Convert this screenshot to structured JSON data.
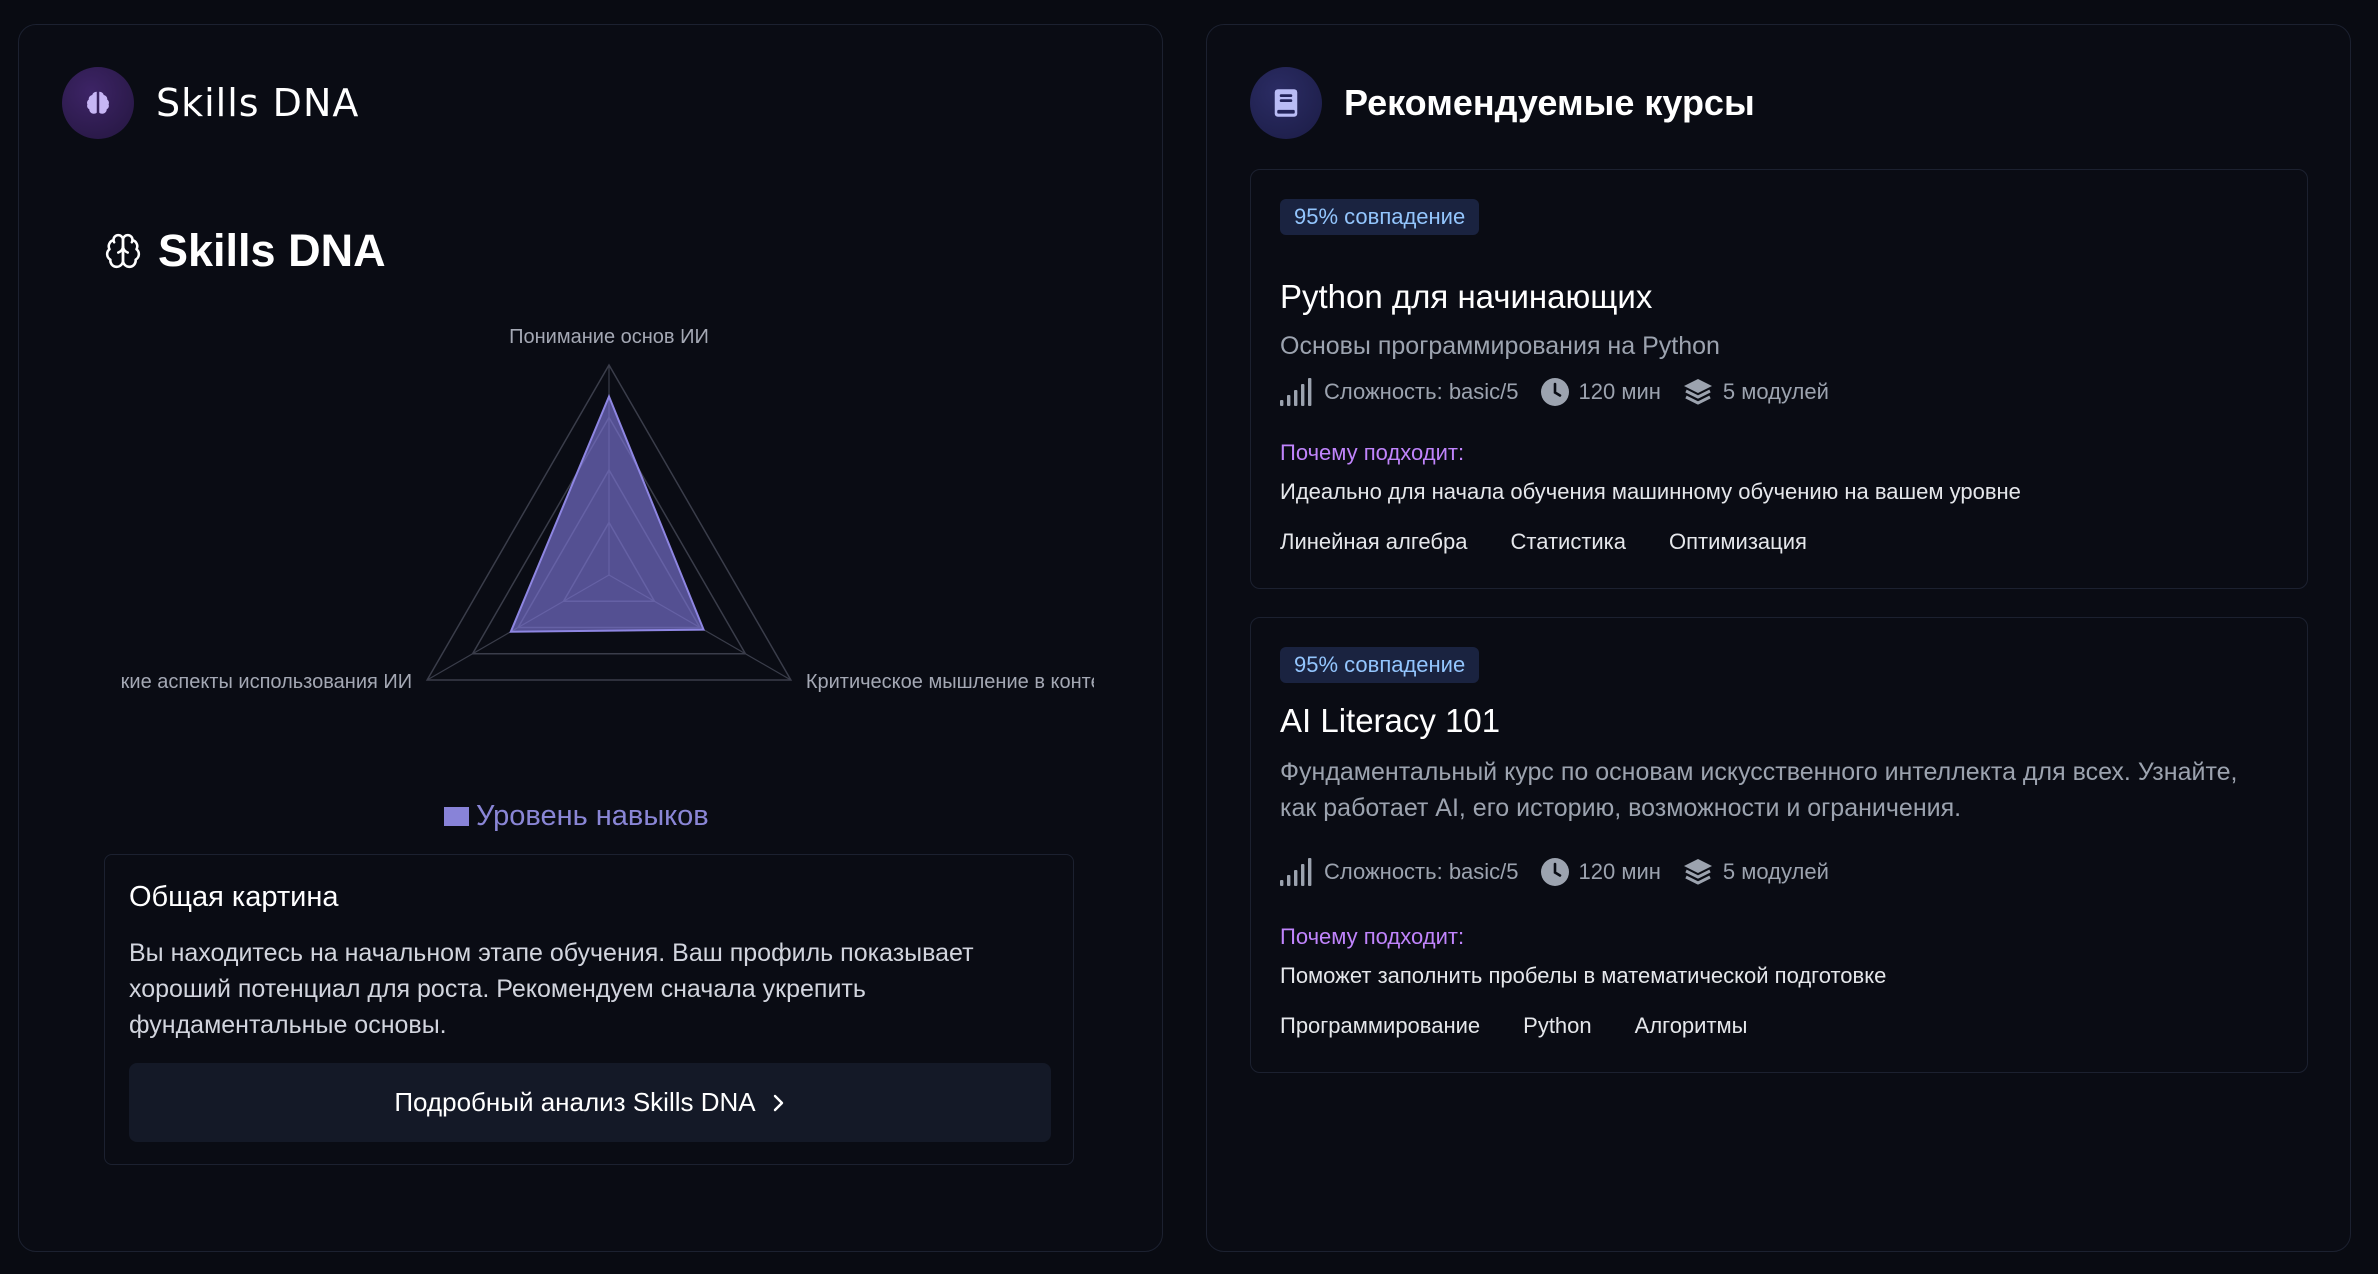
{
  "skills_panel": {
    "logo_title": "Skills DNA",
    "heading": "Skills DNA",
    "legend_label": "Уровень навыков",
    "summary": {
      "title": "Общая картина",
      "text": "Вы находитесь на начальном этапе обучения. Ваш профиль показывает хороший потенциал для роста. Рекомендуем сначала укрепить фундаментальные основы.",
      "button_label": "Подробный анализ Skills DNA"
    }
  },
  "chart_data": {
    "type": "radar",
    "axes": [
      "Понимание основ ИИ",
      "Критическое мышление в конте",
      "кие аспекты использования ИИ"
    ],
    "series": [
      {
        "name": "Уровень навыков",
        "values": [
          0.85,
          0.52,
          0.54
        ]
      }
    ],
    "rings": 4,
    "range": [
      0,
      1
    ],
    "legend": "bottom",
    "colors": {
      "fill": "#7c74d6",
      "stroke": "#8e86e2",
      "grid": "#3a3d4a"
    }
  },
  "courses_panel": {
    "title": "Рекомендуемые курсы",
    "why_label": "Почему подходит:",
    "courses": [
      {
        "match": "95% совпадение",
        "title": "Python для начинающих",
        "description": "Основы программирования на Python",
        "difficulty": "Сложность: basic/5",
        "duration": "120 мин",
        "modules": "5 модулей",
        "why": "Идеально для начала обучения машинному обучению на вашем уровне",
        "tags": [
          "Линейная алгебра",
          "Статистика",
          "Оптимизация"
        ]
      },
      {
        "match": "95% совпадение",
        "title": "AI Literacy 101",
        "description": "Фундаментальный курс по основам искусственного интеллекта для всех. Узнайте, как работает AI, его историю, возможности и ограничения.",
        "difficulty": "Сложность: basic/5",
        "duration": "120 мин",
        "modules": "5 модулей",
        "why": "Поможет заполнить пробелы в математической подготовке",
        "tags": [
          "Программирование",
          "Python",
          "Алгоритмы"
        ]
      }
    ]
  },
  "icons": {
    "brain": "brain-icon",
    "book": "book-icon",
    "signal": "signal-bars-icon",
    "clock": "clock-icon",
    "layers": "layers-icon",
    "chevron": "chevron-right-icon"
  },
  "colors": {
    "background": "#090b12",
    "accent_purple": "#c084fc",
    "badge_blue": "#93c5fd",
    "radar_fill": "#7c74d6"
  }
}
